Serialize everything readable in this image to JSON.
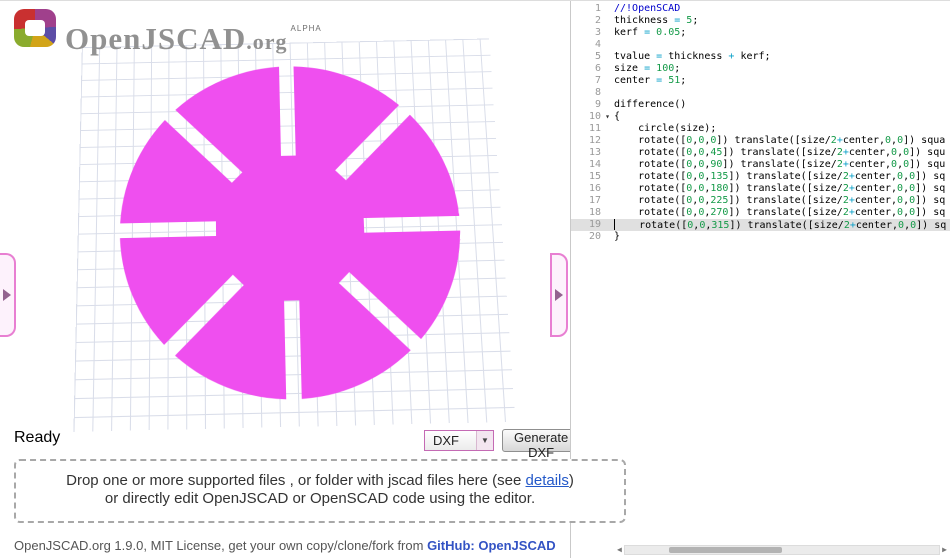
{
  "app": {
    "logo_text": "OpenJSCAD",
    "logo_suffix": ".org",
    "logo_badge": "ALPHA"
  },
  "viewer": {
    "status": "Ready",
    "shape_color": "#ef4fef",
    "grid_line_color": "#d9dde9"
  },
  "controls": {
    "format_select": {
      "value": "DXF",
      "arrow": "▼"
    },
    "generate_button": "Generate DXF"
  },
  "dropzone": {
    "line1_before": "Drop one or more supported files , or folder with jscad files here (see ",
    "link": "details",
    "line1_after": ")",
    "line2": "or directly edit OpenJSCAD or OpenSCAD code using the editor."
  },
  "footer": {
    "text": "OpenJSCAD.org 1.9.0, MIT License, get your own copy/clone/fork from ",
    "link": "GitHub: OpenJSCAD"
  },
  "scrollbar": {
    "left_arrow": "◀",
    "right_arrow": "▶"
  },
  "editor": {
    "colors": {
      "plain": "#000000",
      "number": "#149a48",
      "operator": "#0aa0c8",
      "comment": "#0000cc",
      "active_line_bg": "#e0e0e0",
      "gutter": "#999999"
    },
    "active_line": 19,
    "lines": [
      {
        "num": "1",
        "segments": [
          {
            "t": "//!OpenSCAD",
            "c": "cm"
          }
        ]
      },
      {
        "num": "2",
        "segments": [
          {
            "t": "thickness ",
            "c": "p"
          },
          {
            "t": "=",
            "c": "o"
          },
          {
            "t": " ",
            "c": "p"
          },
          {
            "t": "5",
            "c": "n"
          },
          {
            "t": ";",
            "c": "p"
          }
        ]
      },
      {
        "num": "3",
        "segments": [
          {
            "t": "kerf ",
            "c": "p"
          },
          {
            "t": "=",
            "c": "o"
          },
          {
            "t": " ",
            "c": "p"
          },
          {
            "t": "0.05",
            "c": "n"
          },
          {
            "t": ";",
            "c": "p"
          }
        ]
      },
      {
        "num": "4",
        "segments": []
      },
      {
        "num": "5",
        "segments": [
          {
            "t": "tvalue ",
            "c": "p"
          },
          {
            "t": "=",
            "c": "o"
          },
          {
            "t": " thickness ",
            "c": "p"
          },
          {
            "t": "+",
            "c": "o"
          },
          {
            "t": " kerf;",
            "c": "p"
          }
        ]
      },
      {
        "num": "6",
        "segments": [
          {
            "t": "size ",
            "c": "p"
          },
          {
            "t": "=",
            "c": "o"
          },
          {
            "t": " ",
            "c": "p"
          },
          {
            "t": "100",
            "c": "n"
          },
          {
            "t": ";",
            "c": "p"
          }
        ]
      },
      {
        "num": "7",
        "segments": [
          {
            "t": "center ",
            "c": "p"
          },
          {
            "t": "=",
            "c": "o"
          },
          {
            "t": " ",
            "c": "p"
          },
          {
            "t": "51",
            "c": "n"
          },
          {
            "t": ";",
            "c": "p"
          }
        ]
      },
      {
        "num": "8",
        "segments": []
      },
      {
        "num": "9",
        "segments": [
          {
            "t": "difference()",
            "c": "p"
          }
        ]
      },
      {
        "num": "10",
        "fold": true,
        "segments": [
          {
            "t": "{",
            "c": "p"
          }
        ]
      },
      {
        "num": "11",
        "segments": [
          {
            "t": "    circle(size);",
            "c": "p"
          }
        ]
      },
      {
        "num": "12",
        "segments": [
          {
            "t": "    rotate([",
            "c": "p"
          },
          {
            "t": "0",
            "c": "n"
          },
          {
            "t": ",",
            "c": "p"
          },
          {
            "t": "0",
            "c": "n"
          },
          {
            "t": ",",
            "c": "p"
          },
          {
            "t": "0",
            "c": "n"
          },
          {
            "t": "]) translate([size/",
            "c": "p"
          },
          {
            "t": "2",
            "c": "n"
          },
          {
            "t": "+",
            "c": "o"
          },
          {
            "t": "center,",
            "c": "p"
          },
          {
            "t": "0",
            "c": "n"
          },
          {
            "t": ",",
            "c": "p"
          },
          {
            "t": "0",
            "c": "n"
          },
          {
            "t": "]) squa",
            "c": "p"
          }
        ]
      },
      {
        "num": "13",
        "segments": [
          {
            "t": "    rotate([",
            "c": "p"
          },
          {
            "t": "0",
            "c": "n"
          },
          {
            "t": ",",
            "c": "p"
          },
          {
            "t": "0",
            "c": "n"
          },
          {
            "t": ",",
            "c": "p"
          },
          {
            "t": "45",
            "c": "n"
          },
          {
            "t": "]) translate([size/",
            "c": "p"
          },
          {
            "t": "2",
            "c": "n"
          },
          {
            "t": "+",
            "c": "o"
          },
          {
            "t": "center,",
            "c": "p"
          },
          {
            "t": "0",
            "c": "n"
          },
          {
            "t": ",",
            "c": "p"
          },
          {
            "t": "0",
            "c": "n"
          },
          {
            "t": "]) squ",
            "c": "p"
          }
        ]
      },
      {
        "num": "14",
        "segments": [
          {
            "t": "    rotate([",
            "c": "p"
          },
          {
            "t": "0",
            "c": "n"
          },
          {
            "t": ",",
            "c": "p"
          },
          {
            "t": "0",
            "c": "n"
          },
          {
            "t": ",",
            "c": "p"
          },
          {
            "t": "90",
            "c": "n"
          },
          {
            "t": "]) translate([size/",
            "c": "p"
          },
          {
            "t": "2",
            "c": "n"
          },
          {
            "t": "+",
            "c": "o"
          },
          {
            "t": "center,",
            "c": "p"
          },
          {
            "t": "0",
            "c": "n"
          },
          {
            "t": ",",
            "c": "p"
          },
          {
            "t": "0",
            "c": "n"
          },
          {
            "t": "]) squ",
            "c": "p"
          }
        ]
      },
      {
        "num": "15",
        "segments": [
          {
            "t": "    rotate([",
            "c": "p"
          },
          {
            "t": "0",
            "c": "n"
          },
          {
            "t": ",",
            "c": "p"
          },
          {
            "t": "0",
            "c": "n"
          },
          {
            "t": ",",
            "c": "p"
          },
          {
            "t": "135",
            "c": "n"
          },
          {
            "t": "]) translate([size/",
            "c": "p"
          },
          {
            "t": "2",
            "c": "n"
          },
          {
            "t": "+",
            "c": "o"
          },
          {
            "t": "center,",
            "c": "p"
          },
          {
            "t": "0",
            "c": "n"
          },
          {
            "t": ",",
            "c": "p"
          },
          {
            "t": "0",
            "c": "n"
          },
          {
            "t": "]) sq",
            "c": "p"
          }
        ]
      },
      {
        "num": "16",
        "segments": [
          {
            "t": "    rotate([",
            "c": "p"
          },
          {
            "t": "0",
            "c": "n"
          },
          {
            "t": ",",
            "c": "p"
          },
          {
            "t": "0",
            "c": "n"
          },
          {
            "t": ",",
            "c": "p"
          },
          {
            "t": "180",
            "c": "n"
          },
          {
            "t": "]) translate([size/",
            "c": "p"
          },
          {
            "t": "2",
            "c": "n"
          },
          {
            "t": "+",
            "c": "o"
          },
          {
            "t": "center,",
            "c": "p"
          },
          {
            "t": "0",
            "c": "n"
          },
          {
            "t": ",",
            "c": "p"
          },
          {
            "t": "0",
            "c": "n"
          },
          {
            "t": "]) sq",
            "c": "p"
          }
        ]
      },
      {
        "num": "17",
        "segments": [
          {
            "t": "    rotate([",
            "c": "p"
          },
          {
            "t": "0",
            "c": "n"
          },
          {
            "t": ",",
            "c": "p"
          },
          {
            "t": "0",
            "c": "n"
          },
          {
            "t": ",",
            "c": "p"
          },
          {
            "t": "225",
            "c": "n"
          },
          {
            "t": "]) translate([size/",
            "c": "p"
          },
          {
            "t": "2",
            "c": "n"
          },
          {
            "t": "+",
            "c": "o"
          },
          {
            "t": "center,",
            "c": "p"
          },
          {
            "t": "0",
            "c": "n"
          },
          {
            "t": ",",
            "c": "p"
          },
          {
            "t": "0",
            "c": "n"
          },
          {
            "t": "]) sq",
            "c": "p"
          }
        ]
      },
      {
        "num": "18",
        "segments": [
          {
            "t": "    rotate([",
            "c": "p"
          },
          {
            "t": "0",
            "c": "n"
          },
          {
            "t": ",",
            "c": "p"
          },
          {
            "t": "0",
            "c": "n"
          },
          {
            "t": ",",
            "c": "p"
          },
          {
            "t": "270",
            "c": "n"
          },
          {
            "t": "]) translate([size/",
            "c": "p"
          },
          {
            "t": "2",
            "c": "n"
          },
          {
            "t": "+",
            "c": "o"
          },
          {
            "t": "center,",
            "c": "p"
          },
          {
            "t": "0",
            "c": "n"
          },
          {
            "t": ",",
            "c": "p"
          },
          {
            "t": "0",
            "c": "n"
          },
          {
            "t": "]) sq",
            "c": "p"
          }
        ]
      },
      {
        "num": "19",
        "active": true,
        "cursor": true,
        "segments": [
          {
            "t": "    rotate([",
            "c": "p"
          },
          {
            "t": "0",
            "c": "n"
          },
          {
            "t": ",",
            "c": "p"
          },
          {
            "t": "0",
            "c": "n"
          },
          {
            "t": ",",
            "c": "p"
          },
          {
            "t": "315",
            "c": "n"
          },
          {
            "t": "]) translate([size/",
            "c": "p"
          },
          {
            "t": "2",
            "c": "n"
          },
          {
            "t": "+",
            "c": "o"
          },
          {
            "t": "center,",
            "c": "p"
          },
          {
            "t": "0",
            "c": "n"
          },
          {
            "t": ",",
            "c": "p"
          },
          {
            "t": "0",
            "c": "n"
          },
          {
            "t": "]) sq",
            "c": "p"
          }
        ]
      },
      {
        "num": "20",
        "segments": [
          {
            "t": "}",
            "c": "p"
          }
        ]
      }
    ]
  }
}
